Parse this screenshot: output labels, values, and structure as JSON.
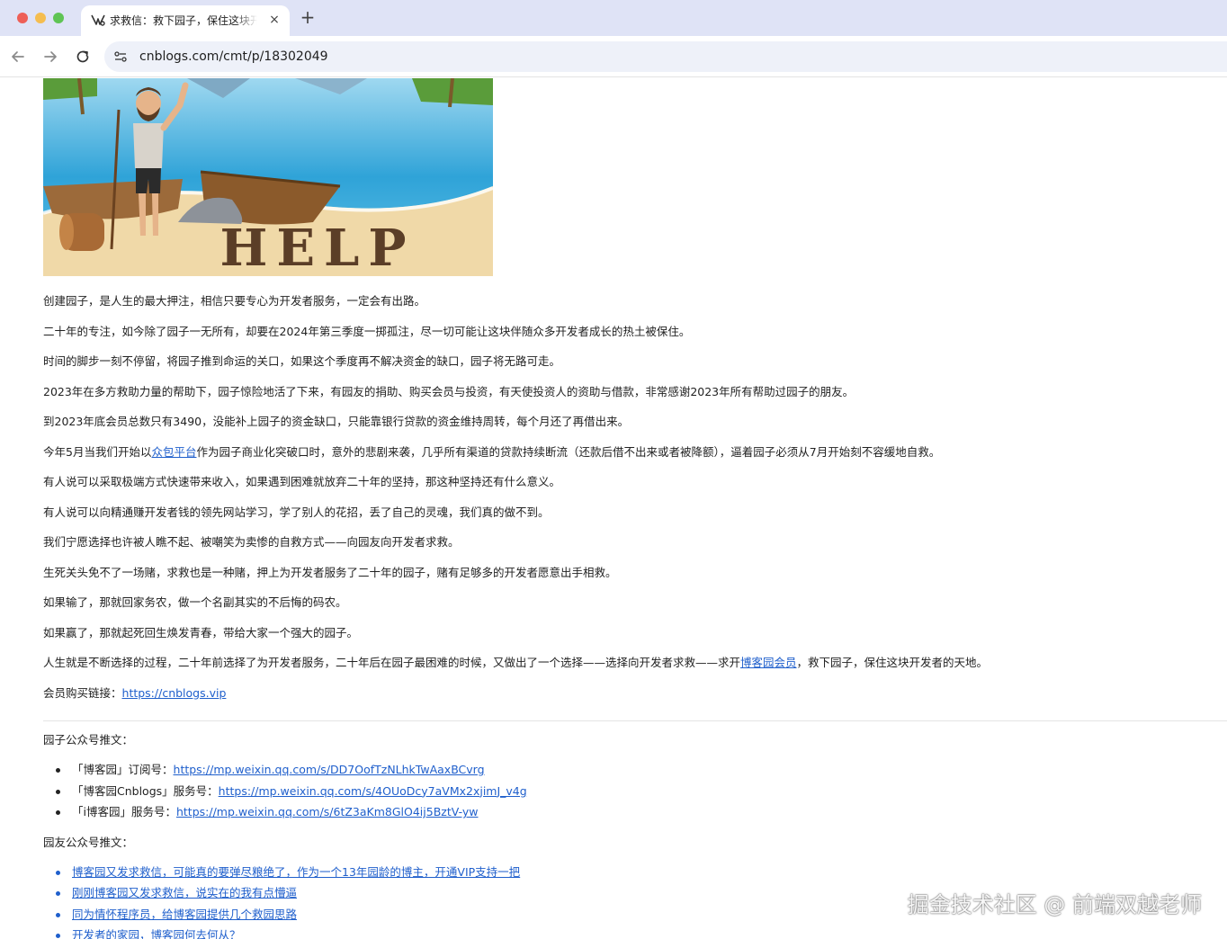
{
  "browser": {
    "tab_title": "求救信：救下园子，保住这块开发者的天地",
    "url": "cnblogs.com/cmt/p/18302049",
    "new_tab_label": "+",
    "close_label": "×"
  },
  "hero_image": {
    "word": "HELP"
  },
  "article": {
    "paragraphs": [
      {
        "text": "创建园子，是人生的最大押注，相信只要专心为开发者服务，一定会有出路。"
      },
      {
        "text": "二十年的专注，如今除了园子一无所有，却要在2024年第三季度一掷孤注，尽一切可能让这块伴随众多开发者成长的热土被保住。"
      },
      {
        "text": "时间的脚步一刻不停留，将园子推到命运的关口，如果这个季度再不解决资金的缺口，园子将无路可走。"
      },
      {
        "text": "2023年在多方救助力量的帮助下，园子惊险地活了下来，有园友的捐助、购买会员与投资，有天使投资人的资助与借款，非常感谢2023年所有帮助过园子的朋友。"
      },
      {
        "text": "到2023年底会员总数只有3490，没能补上园子的资金缺口，只能靠银行贷款的资金维持周转，每个月还了再借出来。"
      },
      {
        "before": "今年5月当我们开始以",
        "link": "众包平台",
        "after": "作为园子商业化突破口时，意外的悲剧来袭，几乎所有渠道的贷款持续断流（还款后借不出来或者被降额），逼着园子必须从7月开始刻不容缓地自救。"
      },
      {
        "text": "有人说可以采取极端方式快速带来收入，如果遇到困难就放弃二十年的坚持，那这种坚持还有什么意义。"
      },
      {
        "text": "有人说可以向精通赚开发者钱的领先网站学习，学了别人的花招，丢了自己的灵魂，我们真的做不到。"
      },
      {
        "text": "我们宁愿选择也许被人瞧不起、被嘲笑为卖惨的自救方式——向园友向开发者求救。"
      },
      {
        "text": "生死关头免不了一场赌，求救也是一种赌，押上为开发者服务了二十年的园子，赌有足够多的开发者愿意出手相救。"
      },
      {
        "text": "如果输了，那就回家务农，做一个名副其实的不后悔的码农。"
      },
      {
        "text": "如果赢了，那就起死回生焕发青春，带给大家一个强大的园子。"
      },
      {
        "before": "人生就是不断选择的过程，二十年前选择了为开发者服务，二十年后在园子最困难的时候，又做出了一个选择——选择向开发者求救——求开",
        "link": "博客园会员",
        "after": "，救下园子，保住这块开发者的天地。"
      },
      {
        "before": "会员购买链接：",
        "link": "https://cnblogs.vip",
        "after": ""
      }
    ],
    "official_title": "园子公众号推文：",
    "official_items": [
      {
        "label": "「博客园」订阅号：",
        "link": "https://mp.weixin.qq.com/s/DD7OofTzNLhkTwAaxBCvrg"
      },
      {
        "label": "「博客园Cnblogs」服务号：",
        "link": "https://mp.weixin.qq.com/s/4OUoDcy7aVMx2xjimJ_v4g"
      },
      {
        "label": "「i博客园」服务号：",
        "link": "https://mp.weixin.qq.com/s/6tZ3aKm8GlO4ij5BztV-yw"
      }
    ],
    "friends_title": "园友公众号推文：",
    "friends_items": [
      "博客园又发求救信，可能真的要弹尽粮绝了，作为一个13年园龄的博主，开通VIP支持一把",
      "刚刚博客园又发求救信，说实在的我有点懵逼",
      "同为情怀程序员，给博客园提供几个救园思路",
      "开发者的家园，博客园何去何从？"
    ]
  },
  "watermark": "掘金技术社区 @ 前端双越老师",
  "colors": {
    "tabbar": "#dfe3f6",
    "link": "#1f5fcc",
    "sea": "#2fa3d8",
    "sand": "#f0d9a8"
  }
}
